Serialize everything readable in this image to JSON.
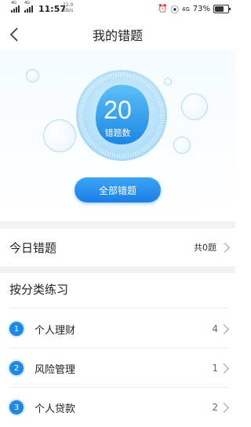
{
  "status_bar": {
    "sig1": "4G",
    "sig2": "4G",
    "time": "11:57",
    "speed_value": "22.0",
    "speed_unit": "KB/s",
    "net": "4G",
    "battery": "73%"
  },
  "header": {
    "title": "我的错题"
  },
  "summary": {
    "count": "20",
    "count_label": "错题数",
    "all_button": "全部错题"
  },
  "today": {
    "label": "今日错题",
    "count_text": "共0题"
  },
  "categories": {
    "title": "按分类练习",
    "items": [
      {
        "num": "1",
        "name": "个人理财",
        "value": "4"
      },
      {
        "num": "2",
        "name": "风险管理",
        "value": "1"
      },
      {
        "num": "3",
        "name": "个人贷款",
        "value": "2"
      }
    ]
  },
  "colors": {
    "accent": "#1e88e5",
    "gauge_light": "#bfe3fb"
  }
}
